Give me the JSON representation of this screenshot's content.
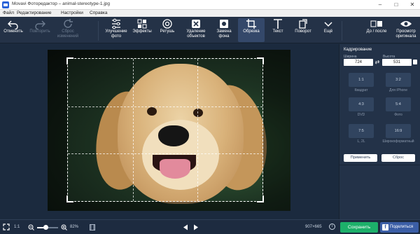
{
  "window": {
    "title": "Movavi Фоторедактор – animal-stereotype-1.jpg",
    "minimize": "–",
    "maximize": "□",
    "close": "✕"
  },
  "menu": [
    "Файл",
    "Редактирование",
    "Настройки",
    "Справка"
  ],
  "toolbar": {
    "undo": "Отменить",
    "redo": "Повторить",
    "reset_changes": [
      "Сброс",
      "изменений"
    ],
    "enhance": [
      "Улучшение",
      "фото"
    ],
    "effects": "Эффекты",
    "retouch": "Ретушь",
    "remove_objects": [
      "Удаление",
      "объектов"
    ],
    "replace_bg": [
      "Замена",
      "фона"
    ],
    "crop": "Обрезка",
    "text": "Текст",
    "rotate": "Поворот",
    "more": "Ещё",
    "before_after": "До / после",
    "view_original": [
      "Просмотр",
      "оригинала"
    ]
  },
  "panel": {
    "title": "Кадрирование",
    "width_label": "Ширина",
    "height_label": "Высота",
    "width_value": "724",
    "height_value": "531",
    "ratios": [
      {
        "value": "1:1",
        "caption": "Квадрат"
      },
      {
        "value": "3:2",
        "caption": "Для iPhone"
      },
      {
        "value": "4:3",
        "caption": "DVD"
      },
      {
        "value": "5:4",
        "caption": "Фото"
      },
      {
        "value": "7:5",
        "caption": "L, 2L"
      },
      {
        "value": "16:9",
        "caption": "Широкоформатный"
      }
    ],
    "apply": "Применить",
    "reset": "Сброс"
  },
  "status": {
    "ratio": "1:1",
    "zoom": "82%",
    "dimensions": "907×665",
    "info": "i",
    "save": "Сохранить",
    "share": "Поделиться",
    "zoom_level": 0.4
  }
}
